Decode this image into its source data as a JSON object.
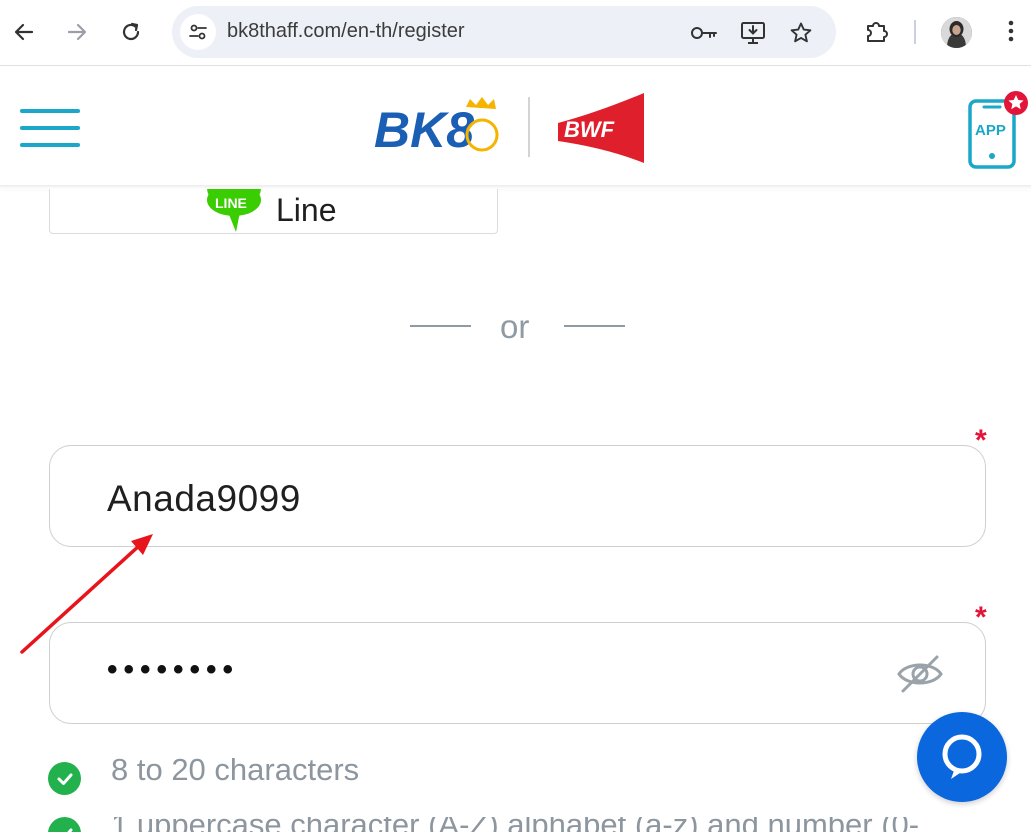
{
  "browser": {
    "url": "bk8thaff.com/en-th/register"
  },
  "header": {
    "bk8_logo_text": "BK8",
    "bwf_logo_text": "BWF",
    "app_label": "APP"
  },
  "social_login": {
    "line_badge": "LINE",
    "line_label": "Line"
  },
  "divider": {
    "or_text": "or"
  },
  "form": {
    "required_mark": "*",
    "username_value": "Anada9099",
    "password_masked": "••••••••"
  },
  "password_rules": [
    {
      "text": "8 to 20 characters",
      "status": "passed"
    },
    {
      "text": "1 uppercase character (A-Z) alphabet (a-z) and number (0-",
      "status": "passed"
    }
  ],
  "colors": {
    "accent": "#1aa7c9",
    "required": "#e3143a",
    "check": "#22b14c",
    "chat": "#0a67dd",
    "bwf_red": "#e01f2d",
    "bk8_blue": "#1a5fb4",
    "bk8_gold": "#f5b400",
    "line_green": "#3acd01",
    "annotation": "#e8141c"
  }
}
